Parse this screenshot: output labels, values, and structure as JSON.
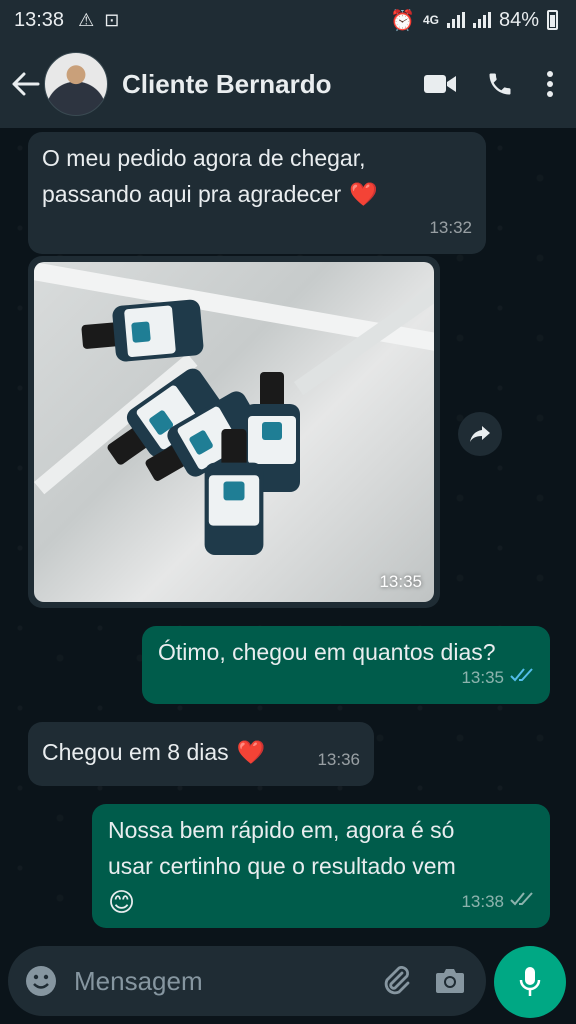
{
  "status_bar": {
    "time": "13:38",
    "network": "4G",
    "battery": "84%"
  },
  "header": {
    "contact_name": "Cliente Bernardo"
  },
  "messages": [
    {
      "line1": "O meu pedido agora de chegar,",
      "line2": "passando aqui pra agradecer",
      "emoji": "❤️",
      "time": "13:32"
    },
    {
      "photo_time": "13:35"
    },
    {
      "text": "Ótimo, chegou em quantos dias?",
      "time": "13:35"
    },
    {
      "text": "Chegou em 8 dias",
      "emoji": "❤️",
      "time": "13:36"
    },
    {
      "line1": "Nossa bem rápido em, agora é só",
      "line2": "usar certinho que o resultado vem",
      "emoji": "😊",
      "time": "13:38"
    }
  ],
  "input": {
    "placeholder": "Mensagem"
  },
  "colors": {
    "incoming": "#1f2c34",
    "outgoing": "#005c4b",
    "accent": "#00a884",
    "read_ticks": "#53bdeb"
  }
}
